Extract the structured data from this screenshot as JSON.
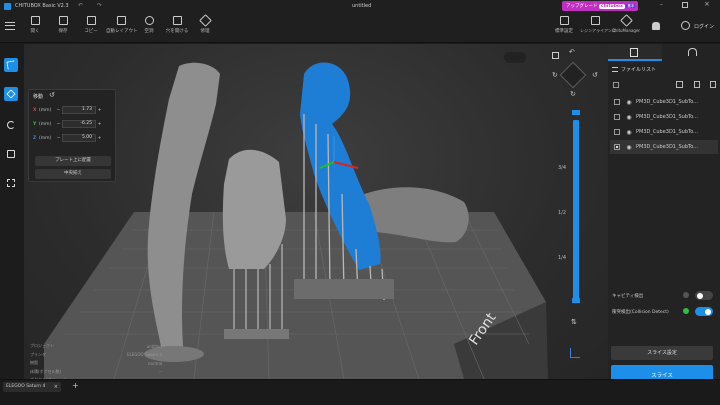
{
  "app": {
    "title": "CHITUBOX Basic V2.3",
    "document": "untitled"
  },
  "topright": {
    "upgrade": "アップグレード",
    "upgrade_brand": "chitubox",
    "upgrade_badge": "基本",
    "login": "ログイン"
  },
  "toolbar": {
    "items": [
      {
        "label": "開く",
        "icon": "open-icon"
      },
      {
        "label": "保存",
        "icon": "save-icon"
      },
      {
        "label": "コピー",
        "icon": "copy-icon"
      },
      {
        "label": "自動レイアウト",
        "icon": "layout-icon"
      },
      {
        "label": "空洞",
        "icon": "hollow-icon"
      },
      {
        "label": "穴を開ける",
        "icon": "hole-icon"
      },
      {
        "label": "修理",
        "icon": "repair-icon"
      }
    ],
    "right_items": [
      {
        "label": "標準設定",
        "icon": "settings-icon"
      },
      {
        "label": "レジンアライアンス",
        "icon": "resin-icon"
      },
      {
        "label": "ChituManager",
        "icon": "manager-icon"
      }
    ]
  },
  "move_panel": {
    "title": "移動",
    "axes": [
      {
        "axis": "X",
        "unit": "(mm)",
        "value": "1.73",
        "color": "#e04040"
      },
      {
        "axis": "Y",
        "unit": "(mm)",
        "value": "-6.25",
        "color": "#40c040"
      },
      {
        "axis": "Z",
        "unit": "(mm)",
        "value": "5.00",
        "color": "#4080e0"
      }
    ],
    "place_button": "プレート上に配置",
    "center_button": "中央揃え"
  },
  "info": [
    {
      "key": "プロジェクト",
      "value": "untitled"
    },
    {
      "key": "プリンタ",
      "value": "ELEGOO Saturn 4"
    },
    {
      "key": "樹脂",
      "value": "normal"
    },
    {
      "key": "体積(ボクセル数)",
      "value": "--"
    },
    {
      "key": "ボクセル/ボリューム",
      "value": "--"
    },
    {
      "key": "ボクセル計算時間",
      "value": "--"
    },
    {
      "key": "予想印刷時間",
      "value": "--"
    }
  ],
  "scene": {
    "front_label": "Front"
  },
  "slider": {
    "ticks": [
      "3/4",
      "1/2",
      "1/4"
    ]
  },
  "file_list": {
    "title": "ファイルリスト",
    "files": [
      {
        "name": "PM3D_Cube3D1_SubTo...",
        "checked": false
      },
      {
        "name": "PM3D_Cube3D1_SubTo...",
        "checked": false
      },
      {
        "name": "PM3D_Cube3D1_SubTo...",
        "checked": false
      },
      {
        "name": "PM3D_Cube3D1_SubTo...",
        "checked": true
      }
    ]
  },
  "options": {
    "cavity": "キャビティ検出",
    "collision": "衝突検出(Collision Detect)"
  },
  "buttons": {
    "slice_settings": "スライス設定",
    "slice": "スライス"
  },
  "bottom": {
    "printer_tab": "ELEGOO Saturn 4"
  },
  "colors": {
    "accent": "#1d8fe8",
    "model_blue": "#1e7ed6",
    "upgrade": "#c030c0"
  }
}
